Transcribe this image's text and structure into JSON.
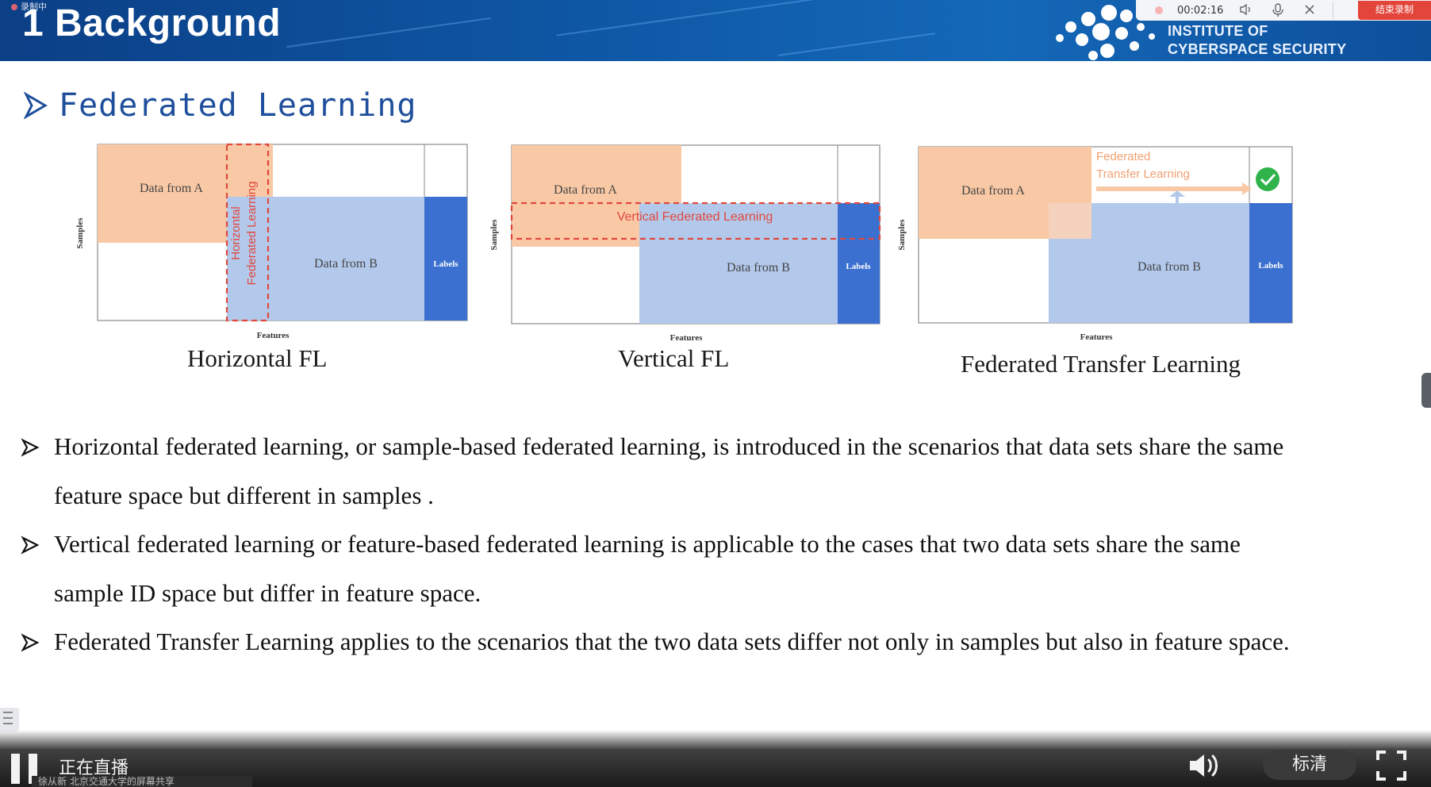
{
  "header": {
    "recording_badge": "录制中",
    "slide_title": "1 Background",
    "institute_line1": "INSTITUTE OF",
    "institute_line2": "CYBERSPACE SECURITY"
  },
  "recorder": {
    "elapsed": "00:02:16",
    "speaker_icon": "speaker-icon",
    "mic_icon": "mic-icon",
    "close_icon": "close-icon",
    "end_label": "结束录制"
  },
  "section": {
    "heading": "Federated Learning"
  },
  "diagrams": [
    {
      "caption": "Horizontal FL",
      "data_a": "Data from A",
      "data_b": "Data from B",
      "labels": "Labels",
      "overlap_line1": "Horizontal",
      "overlap_line2": "Federated Learning",
      "axis_y": "Samples",
      "axis_x": "Features"
    },
    {
      "caption": "Vertical FL",
      "data_a": "Data from A",
      "data_b": "Data from B",
      "labels": "Labels",
      "overlap": "Vertical Federated Learning",
      "axis_y": "Samples",
      "axis_x": "Features"
    },
    {
      "caption": "Federated Transfer Learning",
      "data_a": "Data from A",
      "data_b": "Data from B",
      "labels": "Labels",
      "overlap_line1": "Federated",
      "overlap_line2": "Transfer Learning",
      "axis_y": "Samples",
      "axis_x": "Features"
    }
  ],
  "bullets": [
    {
      "line1": "Horizontal federated learning, or sample-based federated learning, is introduced in the scenarios that data sets share the same",
      "line2": "feature space but different in samples ."
    },
    {
      "line1": "Vertical federated learning or feature-based federated learning is applicable to the cases that two data sets share the same",
      "line2": "sample ID space but differ in feature space."
    },
    {
      "line1": "Federated Transfer Learning applies to the scenarios that the two data sets differ not only in samples but also in feature space.",
      "line2": ""
    }
  ],
  "player": {
    "live_label": "正在直播",
    "ticker": "徐从新 北京交通大学的屏幕共享",
    "quality_label": "标清",
    "pause_icon": "pause-icon",
    "volume_icon": "volume-icon",
    "fullscreen_icon": "fullscreen-icon"
  },
  "colors": {
    "banner": "#0f5aa8",
    "heading": "#1f4f9c",
    "data_a": "#f9c9a6",
    "data_b": "#b3c9ec",
    "labels": "#3b6fd0",
    "overlap_red": "#e0483c",
    "check_green": "#2fb34a",
    "end_button": "#e4453a"
  }
}
